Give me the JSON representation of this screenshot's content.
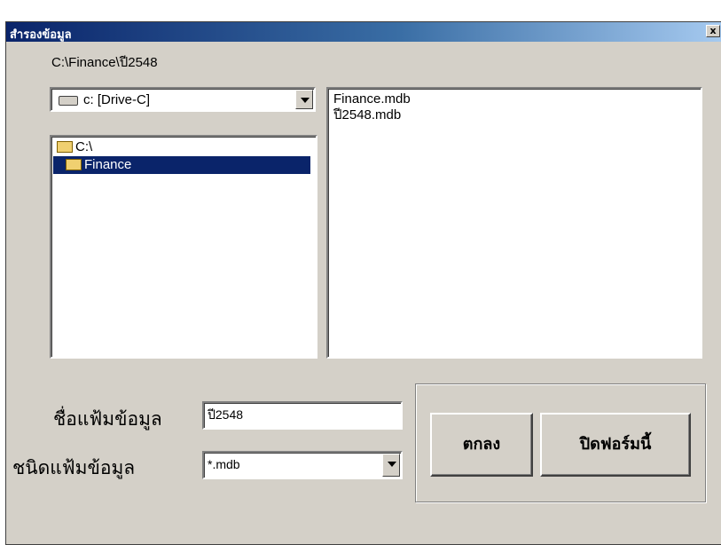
{
  "window": {
    "title": "สำรองข้อมูล",
    "close_glyph": "x"
  },
  "path_label": "C:\\Finance\\ปี2548",
  "drive": {
    "value": "c: [Drive-C]"
  },
  "directories": [
    {
      "label": "C:\\",
      "selected": false
    },
    {
      "label": "Finance",
      "selected": true
    }
  ],
  "files": [
    "Finance.mdb",
    "ปี2548.mdb"
  ],
  "form": {
    "filename_label": "ชื่อแฟ้มข้อมูล",
    "filename_value": "ปี2548",
    "filetype_label": "ชนิดแฟ้มข้อมูล",
    "filetype_value": "*.mdb"
  },
  "buttons": {
    "ok_label": "ตกลง",
    "close_form_label": "ปิดฟอร์มนี้"
  },
  "colors": {
    "title_bar": "#0a246a",
    "selection": "#0a246a",
    "face": "#d4d0c8"
  }
}
